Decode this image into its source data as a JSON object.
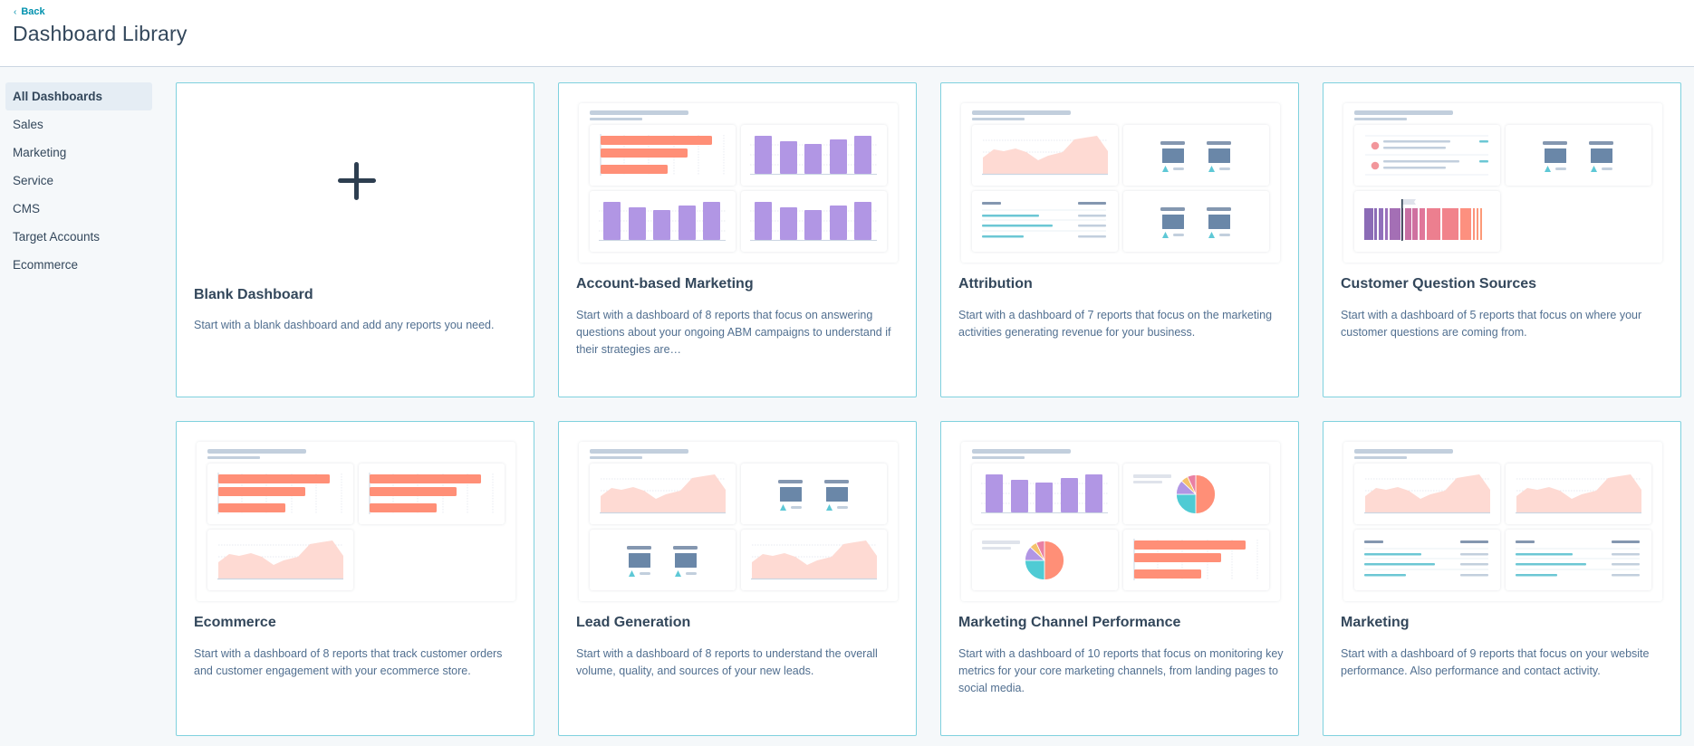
{
  "header": {
    "back_label": "Back",
    "back_icon": "chevron-left-icon",
    "title": "Dashboard Library"
  },
  "sidebar": {
    "active_index": 0,
    "items": [
      {
        "label": "All Dashboards"
      },
      {
        "label": "Sales"
      },
      {
        "label": "Marketing"
      },
      {
        "label": "Service"
      },
      {
        "label": "CMS"
      },
      {
        "label": "Target Accounts"
      },
      {
        "label": "Ecommerce"
      }
    ]
  },
  "colors": {
    "accent_link": "#0091ae",
    "card_border": "#7fd1de",
    "active_nav_bg": "#e5edf4",
    "bar_orange": "#ff8f77",
    "bar_purple": "#b196e4",
    "area_fill": "#fedad3",
    "kpi_block": "#6a87a8",
    "kpi_trend_up": "#5ec8d6",
    "table_teal": "#6cc7d4"
  },
  "cards": [
    {
      "title": "Blank Dashboard",
      "description": "Start with a blank dashboard and add any reports you need.",
      "preview": "plus-icon",
      "tiles": []
    },
    {
      "title": "Account-based Marketing",
      "description": "Start with a dashboard of 8 reports that focus on answering questions about your ongoing ABM campaigns to understand if their strategies are…",
      "preview": "thumbnail",
      "tiles": [
        "hbar",
        "vbar",
        "vbar",
        "vbar"
      ]
    },
    {
      "title": "Attribution",
      "description": "Start with a dashboard of 7 reports that focus on the marketing activities generating revenue for your business.",
      "preview": "thumbnail",
      "tiles": [
        "area",
        "kpi",
        "table",
        "kpi"
      ]
    },
    {
      "title": "Customer Question Sources",
      "description": "Start with a dashboard of 5 reports that focus on where your customer questions are coming from.",
      "preview": "thumbnail",
      "tiles": [
        "list",
        "kpi",
        "timeline"
      ]
    },
    {
      "title": "Ecommerce",
      "description": "Start with a dashboard of 8 reports that track customer orders and customer engagement with your ecommerce store.",
      "preview": "thumbnail",
      "tiles": [
        "hbar",
        "hbar",
        "area"
      ]
    },
    {
      "title": "Lead Generation",
      "description": "Start with a dashboard of 8 reports to understand the overall volume, quality, and sources of your new leads.",
      "preview": "thumbnail",
      "tiles": [
        "area",
        "kpi",
        "kpi",
        "area"
      ]
    },
    {
      "title": "Marketing Channel Performance",
      "description": "Start with a dashboard of 10 reports that focus on monitoring key metrics for your core marketing channels, from landing pages to social media.",
      "preview": "thumbnail",
      "tiles": [
        "vbar",
        "pie",
        "pie",
        "hbar"
      ]
    },
    {
      "title": "Marketing",
      "description": "Start with a dashboard of 9 reports that focus on your website performance. Also performance and contact activity.",
      "preview": "thumbnail",
      "tiles": [
        "area",
        "area",
        "table",
        "table"
      ]
    }
  ]
}
